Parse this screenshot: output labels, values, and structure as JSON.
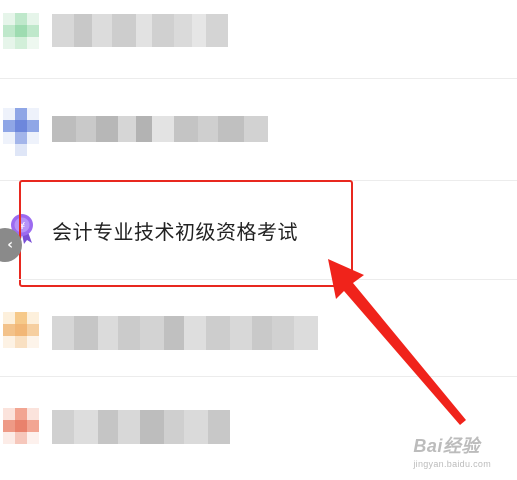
{
  "list": {
    "highlighted_item": {
      "label": "会计专业技术初级资格考试",
      "icon": "medal-badge-icon"
    }
  },
  "navigation": {
    "back_icon": "chevron-left-icon",
    "back_symbol": "‹"
  },
  "annotation": {
    "box_color": "#e8281f",
    "arrow_color": "#f0231b"
  },
  "watermark": {
    "brand": "Bai经验",
    "url": "jingyan.baidu.com"
  }
}
